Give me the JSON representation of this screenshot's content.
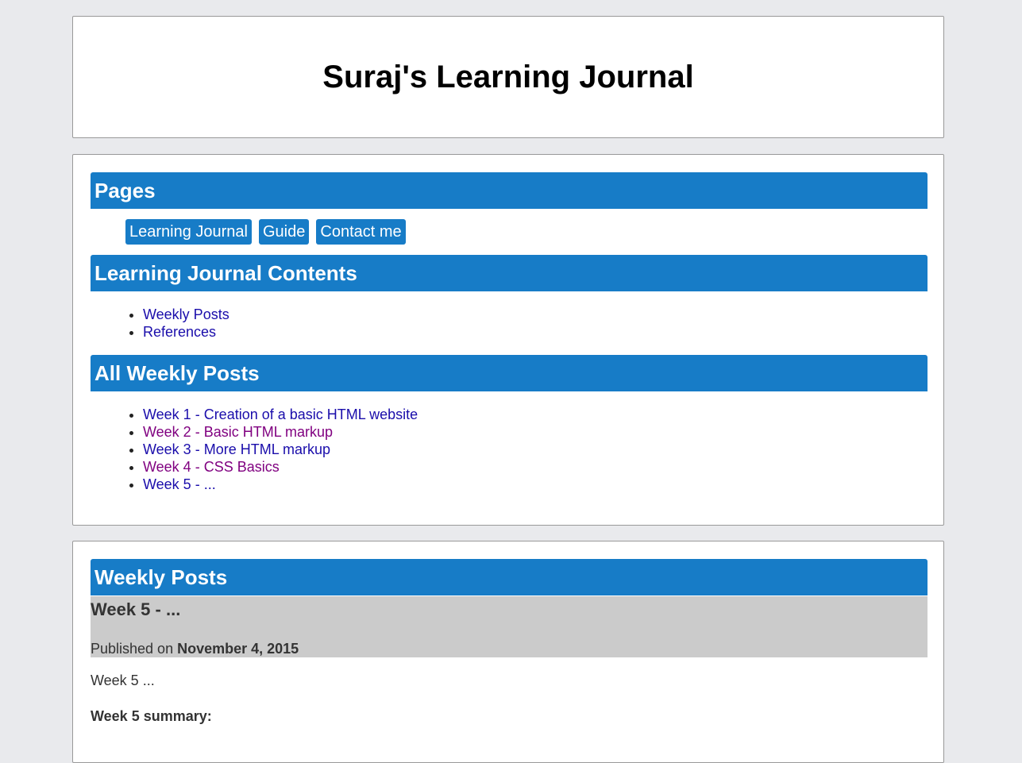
{
  "header": {
    "title": "Suraj's Learning Journal"
  },
  "pages": {
    "heading": "Pages",
    "buttons": [
      "Learning Journal",
      "Guide",
      "Contact me"
    ]
  },
  "contents": {
    "heading": "Learning Journal Contents",
    "links": [
      "Weekly Posts",
      "References"
    ]
  },
  "weekly": {
    "heading": "All Weekly Posts",
    "links": [
      "Week 1 - Creation of a basic HTML website",
      "Week 2 - Basic HTML markup",
      "Week 3 - More HTML markup",
      "Week 4 - CSS Basics",
      "Week 5 - ..."
    ]
  },
  "posts": {
    "heading": "Weekly Posts",
    "post": {
      "title": "Week 5 - ...",
      "published_prefix": "Published on",
      "date": "November 4, 2015",
      "body": "Week 5 ...",
      "summary_label": "Week 5 summary:"
    }
  },
  "colors": {
    "accent": "#177cc7",
    "link": "#1a0dab",
    "visited_link": "#800080",
    "page_bg": "#e9eaed",
    "post_header_bg": "#cbcbcb"
  }
}
